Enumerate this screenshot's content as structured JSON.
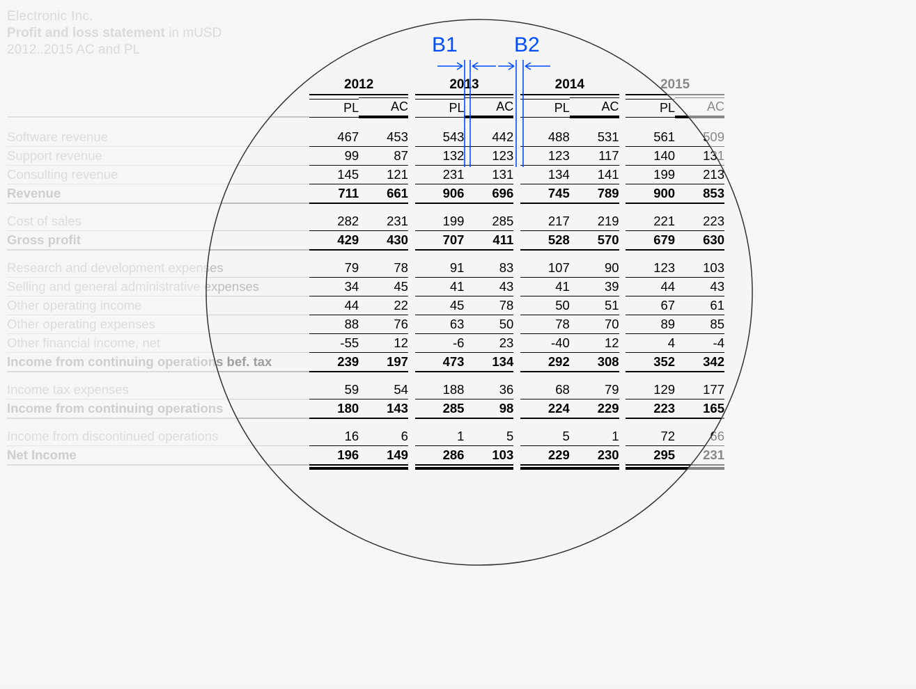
{
  "header": {
    "company": "Electronic Inc.",
    "title": "Profit and loss statement",
    "unit": "in mUSD",
    "period": "2012..2015 AC and PL"
  },
  "years": [
    "2012",
    "2013",
    "2014",
    "2015"
  ],
  "subcols": [
    "PL",
    "AC"
  ],
  "annotations": {
    "b1": "B1",
    "b2": "B2"
  },
  "rows": [
    {
      "label": "Software revenue",
      "bold": false,
      "type": "data",
      "vals": [
        467,
        453,
        543,
        442,
        488,
        531,
        561,
        509
      ]
    },
    {
      "label": "Support revenue",
      "bold": false,
      "type": "data",
      "vals": [
        99,
        87,
        132,
        123,
        123,
        117,
        140,
        131
      ]
    },
    {
      "label": "Consulting revenue",
      "bold": false,
      "type": "data",
      "vals": [
        145,
        121,
        231,
        131,
        134,
        141,
        199,
        213
      ]
    },
    {
      "label": "Revenue",
      "bold": true,
      "type": "subtotal",
      "vals": [
        711,
        661,
        906,
        696,
        745,
        789,
        900,
        853
      ]
    },
    {
      "type": "spacer"
    },
    {
      "label": "Cost of sales",
      "bold": false,
      "type": "data",
      "vals": [
        282,
        231,
        199,
        285,
        217,
        219,
        221,
        223
      ]
    },
    {
      "label": "Gross profit",
      "bold": true,
      "type": "subtotal",
      "vals": [
        429,
        430,
        707,
        411,
        528,
        570,
        679,
        630
      ]
    },
    {
      "type": "spacer"
    },
    {
      "label": "Research and development expenses",
      "bold": false,
      "type": "data",
      "vals": [
        79,
        78,
        91,
        83,
        107,
        90,
        123,
        103
      ]
    },
    {
      "label": "Selling and general administrative expenses",
      "bold": false,
      "type": "data",
      "vals": [
        34,
        45,
        41,
        43,
        41,
        39,
        44,
        43
      ]
    },
    {
      "label": "Other operating income",
      "bold": false,
      "type": "data",
      "vals": [
        44,
        22,
        45,
        78,
        50,
        51,
        67,
        61
      ]
    },
    {
      "label": "Other operating expenses",
      "bold": false,
      "type": "data",
      "vals": [
        88,
        76,
        63,
        50,
        78,
        70,
        89,
        85
      ]
    },
    {
      "label": "Other financial income, net",
      "bold": false,
      "type": "data",
      "vals": [
        -55,
        12,
        -6,
        23,
        -40,
        12,
        4,
        -4
      ]
    },
    {
      "label": "Income from continuing operations bef. tax",
      "bold": true,
      "type": "subtotal",
      "vals": [
        239,
        197,
        473,
        134,
        292,
        308,
        352,
        342
      ]
    },
    {
      "type": "spacer"
    },
    {
      "label": "Income tax expenses",
      "bold": false,
      "type": "data",
      "vals": [
        59,
        54,
        188,
        36,
        68,
        79,
        129,
        177
      ]
    },
    {
      "label": "Income from continuing operations",
      "bold": true,
      "type": "subtotal",
      "vals": [
        180,
        143,
        285,
        98,
        224,
        229,
        223,
        165
      ]
    },
    {
      "type": "spacer"
    },
    {
      "label": "Income from discontinued operations",
      "bold": false,
      "type": "data",
      "vals": [
        16,
        6,
        1,
        5,
        5,
        1,
        72,
        66
      ]
    },
    {
      "label": "Net Income",
      "bold": true,
      "type": "final",
      "vals": [
        196,
        149,
        286,
        103,
        229,
        230,
        295,
        231
      ]
    }
  ],
  "chart_data": {
    "type": "table",
    "title": "Profit and loss statement in mUSD — Electronic Inc. 2012..2015 AC and PL",
    "columns": [
      "2012 PL",
      "2012 AC",
      "2013 PL",
      "2013 AC",
      "2014 PL",
      "2014 AC",
      "2015 PL",
      "2015 AC"
    ],
    "series": [
      {
        "name": "Software revenue",
        "values": [
          467,
          453,
          543,
          442,
          488,
          531,
          561,
          509
        ]
      },
      {
        "name": "Support revenue",
        "values": [
          99,
          87,
          132,
          123,
          123,
          117,
          140,
          131
        ]
      },
      {
        "name": "Consulting revenue",
        "values": [
          145,
          121,
          231,
          131,
          134,
          141,
          199,
          213
        ]
      },
      {
        "name": "Revenue",
        "values": [
          711,
          661,
          906,
          696,
          745,
          789,
          900,
          853
        ]
      },
      {
        "name": "Cost of sales",
        "values": [
          282,
          231,
          199,
          285,
          217,
          219,
          221,
          223
        ]
      },
      {
        "name": "Gross profit",
        "values": [
          429,
          430,
          707,
          411,
          528,
          570,
          679,
          630
        ]
      },
      {
        "name": "Research and development expenses",
        "values": [
          79,
          78,
          91,
          83,
          107,
          90,
          123,
          103
        ]
      },
      {
        "name": "Selling and general administrative expenses",
        "values": [
          34,
          45,
          41,
          43,
          41,
          39,
          44,
          43
        ]
      },
      {
        "name": "Other operating income",
        "values": [
          44,
          22,
          45,
          78,
          50,
          51,
          67,
          61
        ]
      },
      {
        "name": "Other operating expenses",
        "values": [
          88,
          76,
          63,
          50,
          78,
          70,
          89,
          85
        ]
      },
      {
        "name": "Other financial income, net",
        "values": [
          -55,
          12,
          -6,
          23,
          -40,
          12,
          4,
          -4
        ]
      },
      {
        "name": "Income from continuing operations bef. tax",
        "values": [
          239,
          197,
          473,
          134,
          292,
          308,
          352,
          342
        ]
      },
      {
        "name": "Income tax expenses",
        "values": [
          59,
          54,
          188,
          36,
          68,
          79,
          129,
          177
        ]
      },
      {
        "name": "Income from continuing operations",
        "values": [
          180,
          143,
          285,
          98,
          224,
          229,
          223,
          165
        ]
      },
      {
        "name": "Income from discontinued operations",
        "values": [
          16,
          6,
          1,
          5,
          5,
          1,
          72,
          66
        ]
      },
      {
        "name": "Net Income",
        "values": [
          196,
          149,
          286,
          103,
          229,
          230,
          295,
          231
        ]
      }
    ]
  }
}
